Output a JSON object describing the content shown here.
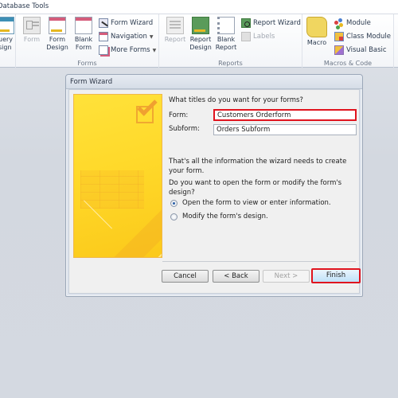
{
  "tabstrip": {
    "active_tab": "Database Tools"
  },
  "ribbon": {
    "query_group": {
      "button": "uery\nsign"
    },
    "forms_group": {
      "label": "Forms",
      "form": "Form",
      "form_design": "Form\nDesign",
      "blank_form": "Blank\nForm",
      "form_wizard": "Form Wizard",
      "navigation": "Navigation",
      "more_forms": "More Forms"
    },
    "reports_group": {
      "label": "Reports",
      "report": "Report",
      "report_design": "Report\nDesign",
      "blank_report": "Blank\nReport",
      "report_wizard": "Report Wizard",
      "labels": "Labels"
    },
    "macros_group": {
      "label": "Macros & Code",
      "macro": "Macro",
      "module": "Module",
      "class_module": "Class Module",
      "visual_basic": "Visual Basic"
    }
  },
  "dialog": {
    "title": "Form Wizard",
    "question": "What titles do you want for your forms?",
    "form_label": "Form:",
    "form_value": "Customers Orderform",
    "subform_label": "Subform:",
    "subform_value": "Orders Subform",
    "info_text": "That's all the information the wizard needs to create your form.",
    "open_question": "Do you want to open the form or modify the form's design?",
    "options": [
      {
        "label": "Open the form to view or enter information.",
        "checked": true
      },
      {
        "label": "Modify the form's design.",
        "checked": false
      }
    ],
    "buttons": {
      "cancel": "Cancel",
      "back": "< Back",
      "next": "Next >",
      "finish": "Finish"
    },
    "highlight_color": "#e0141e"
  }
}
